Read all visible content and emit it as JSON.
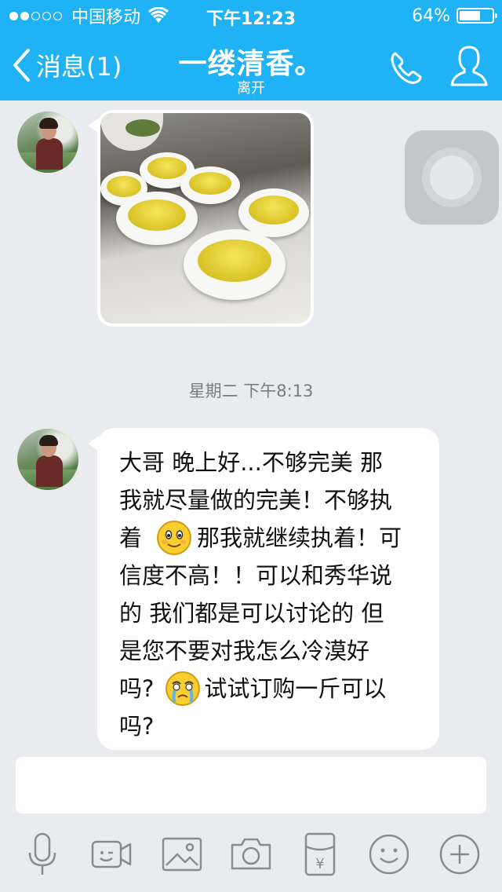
{
  "status_bar": {
    "carrier": "中国移动",
    "time": "下午12:23",
    "battery_pct_label": "64%",
    "battery_level": 0.64,
    "signal_filled": 2,
    "signal_total": 5
  },
  "nav": {
    "back_label": "消息(1)",
    "title": "一缕清香。",
    "subtitle": "离开"
  },
  "chat": {
    "timestamp": "星期二 下午8:13",
    "message_lines": [
      "大哥 晚上好...不够完美 那",
      "我就尽量做的完美！不够执",
      "那我就继续执着！可",
      "信度不高！！可以和秀华说",
      "的 我们都是可以讨论的 但",
      "是您不要对我怎么冷漠好",
      "试试订购一斤可以",
      "吗?"
    ],
    "line3_prefix": "着",
    "line7_prefix": "吗?"
  },
  "input": {
    "placeholder": ""
  },
  "colors": {
    "nav_blue": "#1fb3f5",
    "chat_bg": "#eaebef",
    "bubble": "#ffffff"
  },
  "icons": [
    "microphone-icon",
    "video-call-icon",
    "image-icon",
    "camera-icon",
    "red-packet-icon",
    "emoji-icon",
    "plus-icon"
  ]
}
